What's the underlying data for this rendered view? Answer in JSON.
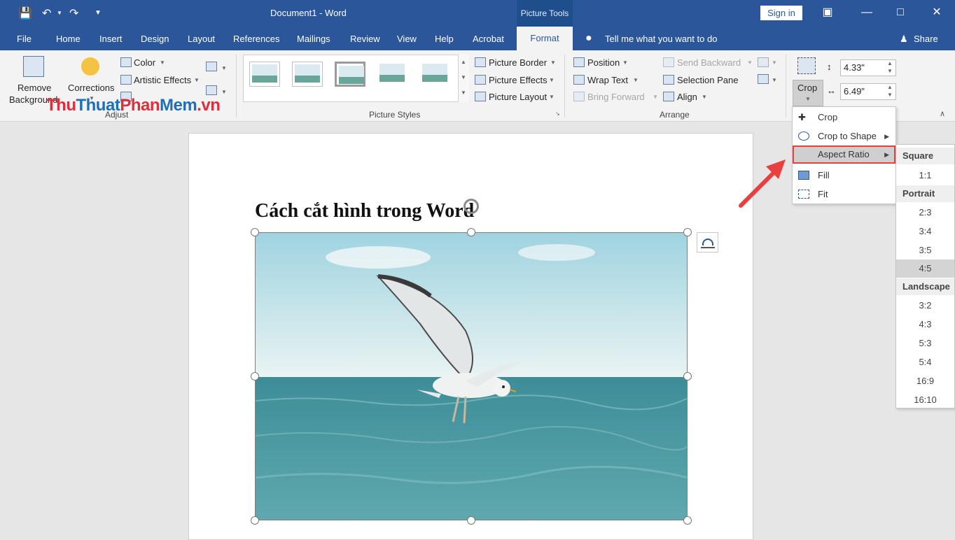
{
  "window": {
    "doc_title": "Document1  -  Word",
    "picture_tools": "Picture Tools",
    "sign_in": "Sign in"
  },
  "tabs": [
    "File",
    "Home",
    "Insert",
    "Design",
    "Layout",
    "References",
    "Mailings",
    "Review",
    "View",
    "Help",
    "Acrobat"
  ],
  "active_tab": "Format",
  "tell_me": "Tell me what you want to do",
  "share": "Share",
  "ribbon": {
    "remove_bg_line1": "Remove",
    "remove_bg_line2": "Background",
    "corrections": "Corrections",
    "color": "Color",
    "artistic_effects": "Artistic Effects",
    "adjust_label": "Adjust",
    "picture_border": "Picture Border",
    "picture_effects": "Picture Effects",
    "picture_layout": "Picture Layout",
    "picture_styles_label": "Picture Styles",
    "position": "Position",
    "wrap_text": "Wrap Text",
    "bring_forward": "Bring Forward",
    "send_backward": "Send Backward",
    "selection_pane": "Selection Pane",
    "align": "Align",
    "arrange_label": "Arrange",
    "crop": "Crop",
    "height": "4.33\"",
    "width": "6.49\""
  },
  "watermark": {
    "part1": "Thu",
    "part2": "Thuat",
    "part3": "Phan",
    "part4": "Mem",
    "part5": ".vn"
  },
  "document": {
    "heading": "Cách cắt hình trong Word"
  },
  "crop_menu": {
    "items": [
      "Crop",
      "Crop to Shape",
      "Aspect Ratio",
      "Fill",
      "Fit"
    ]
  },
  "aspect_menu": {
    "square": "Square",
    "square_items": [
      "1:1"
    ],
    "portrait": "Portrait",
    "portrait_items": [
      "2:3",
      "3:4",
      "3:5",
      "4:5"
    ],
    "landscape": "Landscape",
    "landscape_items": [
      "3:2",
      "4:3",
      "5:3",
      "5:4",
      "16:9",
      "16:10"
    ],
    "selected": "4:5"
  },
  "colors": {
    "title_bar": "#2b579a",
    "highlight_outline": "#e8403e",
    "watermark_red": "#e02e3d",
    "watermark_blue": "#1f6fb5"
  }
}
